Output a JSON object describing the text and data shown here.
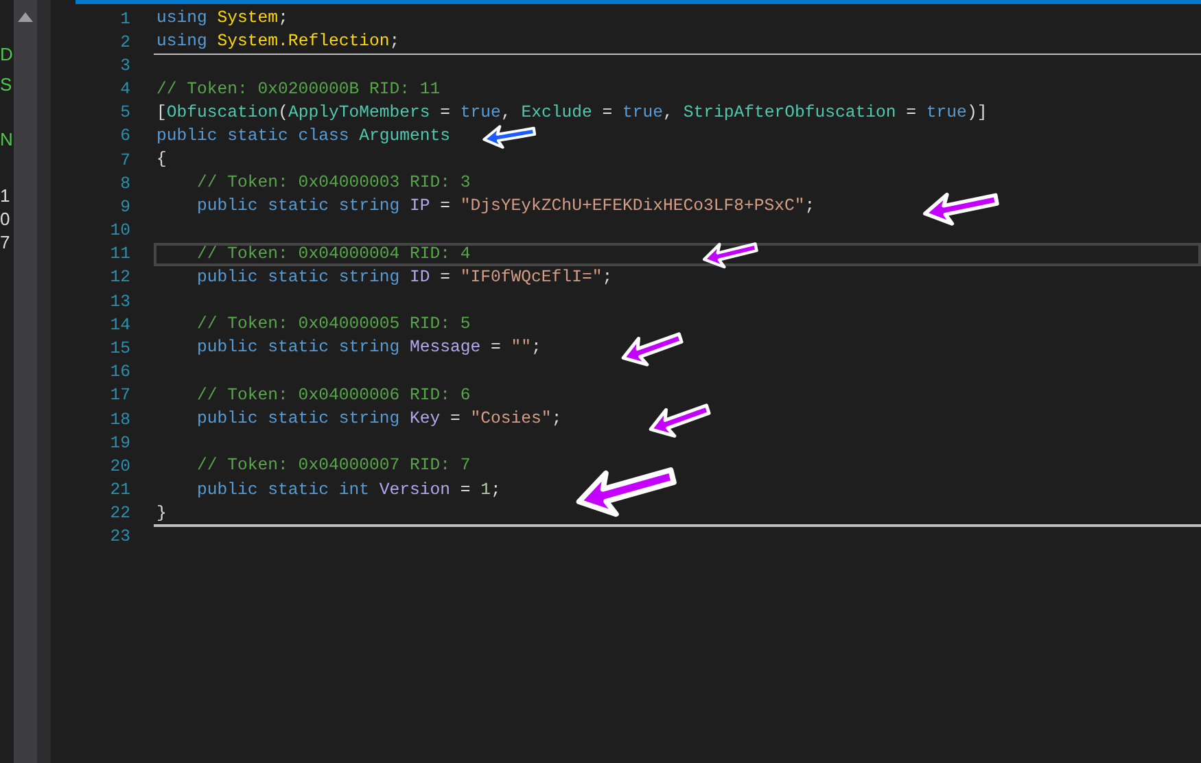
{
  "side_panel": {
    "texts": [
      "D",
      "S",
      "N",
      "1",
      "0",
      "7"
    ]
  },
  "editor": {
    "lines": [
      {
        "number": "1",
        "current": false,
        "separator": false,
        "tokens": [
          {
            "text": "using ",
            "kind": "keyword"
          },
          {
            "text": "System",
            "kind": "namespace"
          },
          {
            "text": ";"
          }
        ]
      },
      {
        "number": "2",
        "current": false,
        "separator": true,
        "tokens": [
          {
            "text": "using ",
            "kind": "keyword"
          },
          {
            "text": "System.Reflection",
            "kind": "namespace"
          },
          {
            "text": ";"
          }
        ]
      },
      {
        "number": "3",
        "current": false,
        "separator": false
      },
      {
        "number": "4",
        "current": false,
        "separator": false,
        "tokens": [
          {
            "text": "// Token: 0x0200000B RID: 11",
            "kind": "comment"
          }
        ]
      },
      {
        "number": "5",
        "current": false,
        "separator": false,
        "tokens": [
          {
            "text": "["
          },
          {
            "text": "Obfuscation",
            "kind": "type"
          },
          {
            "text": "("
          },
          {
            "text": "ApplyToMembers",
            "kind": "type"
          },
          {
            "text": " = "
          },
          {
            "text": "true",
            "kind": "keyword"
          },
          {
            "text": ", "
          },
          {
            "text": "Exclude",
            "kind": "type"
          },
          {
            "text": " = "
          },
          {
            "text": "true",
            "kind": "keyword"
          },
          {
            "text": ", "
          },
          {
            "text": "StripAfterObfuscation",
            "kind": "type"
          },
          {
            "text": " = "
          },
          {
            "text": "true",
            "kind": "keyword"
          },
          {
            "text": ")]"
          }
        ]
      },
      {
        "number": "6",
        "current": false,
        "separator": false,
        "arrow": {
          "color": "#1a5cff"
        },
        "tokens": [
          {
            "text": "public static class ",
            "kind": "keyword"
          },
          {
            "text": "Arguments",
            "kind": "type"
          }
        ]
      },
      {
        "number": "7",
        "current": false,
        "separator": false,
        "tokens": [
          {
            "text": "{"
          }
        ]
      },
      {
        "number": "8",
        "current": false,
        "separator": false,
        "tokens": [
          {
            "text": "    // Token: 0x04000003 RID: 3",
            "kind": "comment"
          }
        ]
      },
      {
        "number": "9",
        "current": false,
        "separator": false,
        "arrow": {
          "color": "#c400ff"
        },
        "tokens": [
          {
            "text": "    public static string ",
            "kind": "keyword"
          },
          {
            "text": "IP",
            "kind": "field"
          },
          {
            "text": " = "
          },
          {
            "text": "\"DjsYEykZChU+EFEKDixHECo3LF8+PSxC\"",
            "kind": "string"
          },
          {
            "text": ";"
          }
        ]
      },
      {
        "number": "10",
        "current": false,
        "separator": false
      },
      {
        "number": "11",
        "current": true,
        "separator": false,
        "arrow": {
          "color": "#c400ff"
        },
        "tokens": [
          {
            "text": "    // Token: 0x04000004 RID: 4",
            "kind": "comment"
          }
        ]
      },
      {
        "number": "12",
        "current": false,
        "separator": false,
        "tokens": [
          {
            "text": "    public static string ",
            "kind": "keyword"
          },
          {
            "text": "ID",
            "kind": "field"
          },
          {
            "text": " = "
          },
          {
            "text": "\"IF0fWQcEflI=\"",
            "kind": "string"
          },
          {
            "text": ";"
          }
        ]
      },
      {
        "number": "13",
        "current": false,
        "separator": false
      },
      {
        "number": "14",
        "current": false,
        "separator": false,
        "tokens": [
          {
            "text": "    // Token: 0x04000005 RID: 5",
            "kind": "comment"
          }
        ]
      },
      {
        "number": "15",
        "current": false,
        "separator": false,
        "arrow": {
          "color": "#c400ff"
        },
        "tokens": [
          {
            "text": "    public static string ",
            "kind": "keyword"
          },
          {
            "text": "Message",
            "kind": "field"
          },
          {
            "text": " = "
          },
          {
            "text": "\"\"",
            "kind": "string"
          },
          {
            "text": ";"
          }
        ]
      },
      {
        "number": "16",
        "current": false,
        "separator": false
      },
      {
        "number": "17",
        "current": false,
        "separator": false,
        "tokens": [
          {
            "text": "    // Token: 0x04000006 RID: 6",
            "kind": "comment"
          }
        ]
      },
      {
        "number": "18",
        "current": false,
        "separator": false,
        "arrow": {
          "color": "#c400ff"
        },
        "tokens": [
          {
            "text": "    public static string ",
            "kind": "keyword"
          },
          {
            "text": "Key",
            "kind": "field"
          },
          {
            "text": " = "
          },
          {
            "text": "\"Cosies\"",
            "kind": "string"
          },
          {
            "text": ";"
          }
        ]
      },
      {
        "number": "19",
        "current": false,
        "separator": false
      },
      {
        "number": "20",
        "current": false,
        "separator": false,
        "tokens": [
          {
            "text": "    // Token: 0x04000007 RID: 7",
            "kind": "comment"
          }
        ]
      },
      {
        "number": "21",
        "current": false,
        "separator": false,
        "arrow": {
          "color": "#c400ff"
        },
        "tokens": [
          {
            "text": "    public static int ",
            "kind": "keyword"
          },
          {
            "text": "Version",
            "kind": "field"
          },
          {
            "text": " = "
          },
          {
            "text": "1",
            "kind": "number"
          },
          {
            "text": ";"
          }
        ]
      },
      {
        "number": "22",
        "current": false,
        "separator": true,
        "tokens": [
          {
            "text": "}"
          }
        ]
      },
      {
        "number": "23",
        "current": false,
        "separator": false
      }
    ]
  }
}
